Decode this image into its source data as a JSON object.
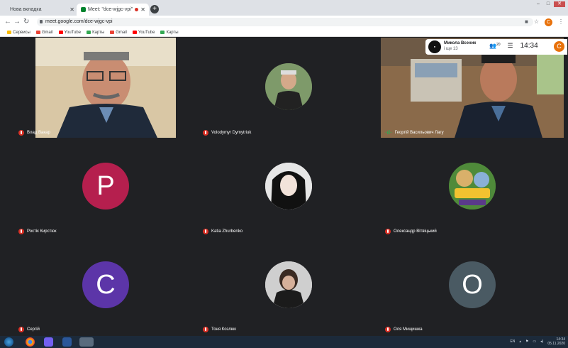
{
  "browser": {
    "tabs": [
      {
        "label": "Нова вкладка",
        "active": false
      },
      {
        "label": "Meet: \"dce-wjgc-vpi\"",
        "active": true
      }
    ],
    "url": "meet.google.com/dce-wjgc-vpi",
    "bookmarks": [
      {
        "label": "Сервисы",
        "color": "#fbbc04"
      },
      {
        "label": "Gmail",
        "color": "#ea4335"
      },
      {
        "label": "YouTube",
        "color": "#ff0000"
      },
      {
        "label": "Карты",
        "color": "#34a853"
      },
      {
        "label": "Gmail",
        "color": "#ea4335"
      },
      {
        "label": "YouTube",
        "color": "#ff0000"
      },
      {
        "label": "Карты",
        "color": "#34a853"
      }
    ],
    "profile_initial": "C"
  },
  "presenter": {
    "name": "Микола Всеник",
    "subtitle": "і ще 13",
    "participants_count": "20",
    "time": "14:34",
    "avatar_initial": "C"
  },
  "participants": [
    {
      "name": "Влад Вакар",
      "muted": true,
      "kind": "video"
    },
    {
      "name": "Volodymyr Dymytriuk",
      "muted": true,
      "kind": "photo"
    },
    {
      "name": "Георгій Васильович Лагу",
      "muted": false,
      "kind": "video"
    },
    {
      "name": "Ростік Кирстюк",
      "muted": true,
      "kind": "initial",
      "initial": "P",
      "color": "#b51f4e"
    },
    {
      "name": "Katia Zhurbenko",
      "muted": true,
      "kind": "photo"
    },
    {
      "name": "Олександр Вітвіцький",
      "muted": true,
      "kind": "photo"
    },
    {
      "name": "Сергій",
      "muted": true,
      "kind": "initial",
      "initial": "C",
      "color": "#5c35a8"
    },
    {
      "name": "Тоня Козлюк",
      "muted": true,
      "kind": "photo"
    },
    {
      "name": "Оля Мищишка",
      "muted": true,
      "kind": "initial",
      "initial": "O",
      "color": "#4a5a63"
    }
  ],
  "taskbar": {
    "language": "EN",
    "time": "14:34",
    "date": "05.11.2020"
  },
  "colors": {
    "meet_bg": "#202124",
    "tile_bg": "#3c4043",
    "mute_red": "#d93025"
  }
}
